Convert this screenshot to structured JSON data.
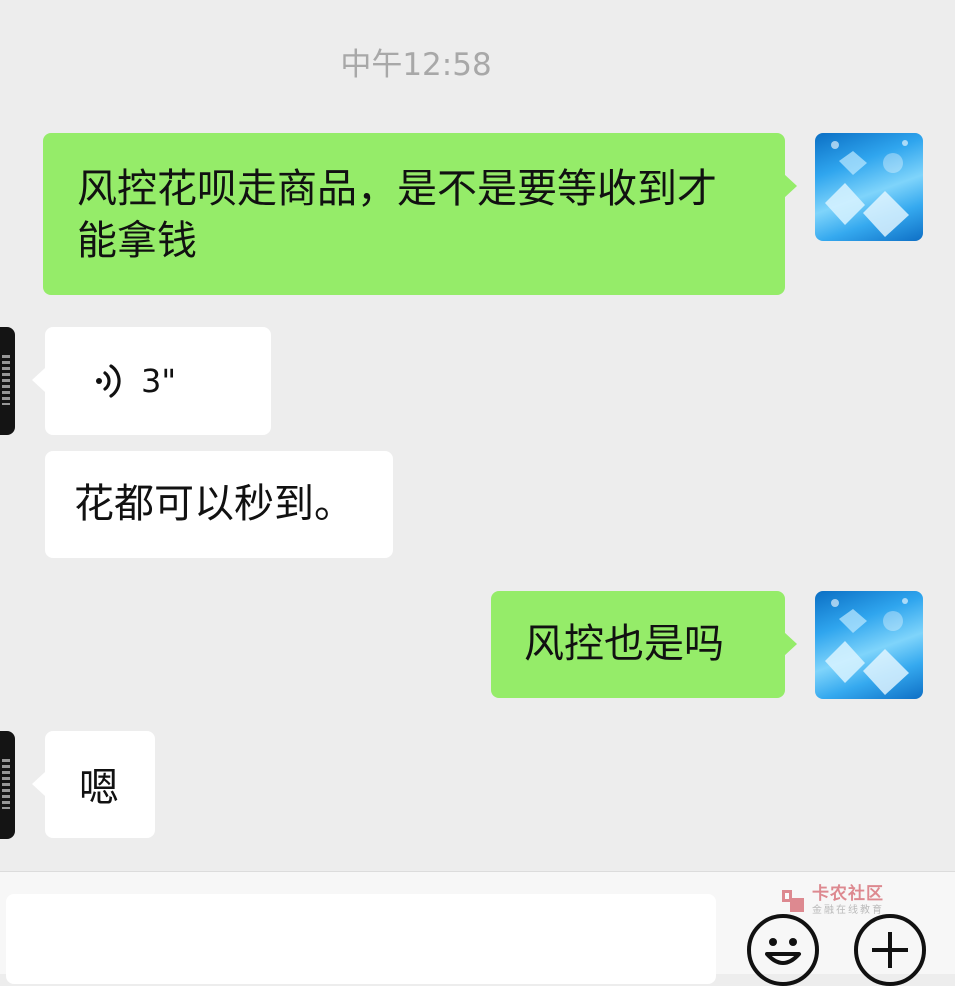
{
  "chat": {
    "timestamp": "中午12:58",
    "messages": [
      {
        "side": "me",
        "type": "text",
        "text": "风控花呗走商品，是不是要等收到才能拿钱"
      },
      {
        "side": "them",
        "type": "voice",
        "duration": "3\""
      },
      {
        "side": "them",
        "type": "text",
        "text": "花都可以秒到。"
      },
      {
        "side": "me",
        "type": "text",
        "text": "风控也是吗"
      },
      {
        "side": "them",
        "type": "text",
        "text": "嗯"
      }
    ]
  },
  "input_bar": {
    "emoji_icon": "smiley-face-icon",
    "more_icon": "plus-circle-icon",
    "watermark_title": "卡农社区",
    "watermark_subtitle": "金融在线教育"
  },
  "colors": {
    "background": "#ededed",
    "my_bubble": "#95ec69",
    "their_bubble": "#ffffff",
    "timestamp": "#a8a8a8",
    "brand_red": "#c8313c"
  }
}
